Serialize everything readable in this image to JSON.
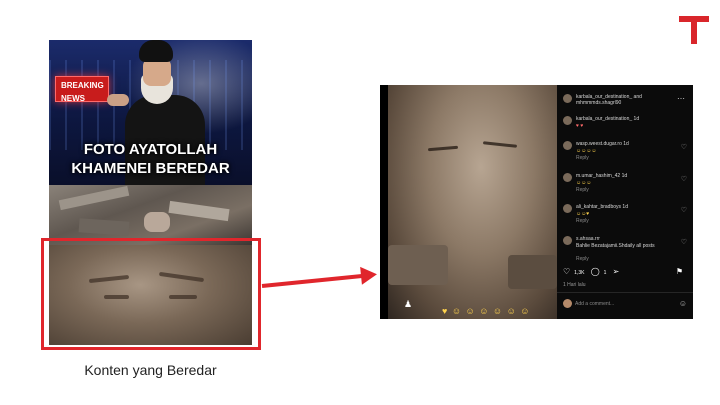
{
  "poster": {
    "breaking_line1": "BREAKING",
    "breaking_line2": "NEWS",
    "caption_line1": "FOTO AYATOLLAH",
    "caption_line2": "KHAMENEI BEREDAR"
  },
  "label": "Konten yang Beredar",
  "colors": {
    "accent": "#e0262c",
    "logo": "#d9262b"
  },
  "instagram": {
    "header_user": "karbala_our_destination_ and",
    "header_user2": "mhmmmds.shagrl90",
    "comments": [
      {
        "user": "karbala_our_destination_ 1d",
        "text": "",
        "sub": ""
      },
      {
        "user": "wasp.weest.dugar.ro 1d",
        "text": "",
        "sub": "Reply"
      },
      {
        "user": "m.umar_hashim_42 1d",
        "text": "",
        "sub": "Reply"
      },
      {
        "user": "ali_kahtar_bradboys 1d",
        "text": "",
        "sub": "Reply"
      },
      {
        "user": "s.ahsaa.rrr",
        "text": "Bahlie Bezatajamii.Shdaily all posts",
        "sub": "Reply"
      }
    ],
    "likes": "1,3K",
    "comments_count": "1",
    "date": "1 Hari lalu",
    "add_comment": "Add a comment..."
  }
}
